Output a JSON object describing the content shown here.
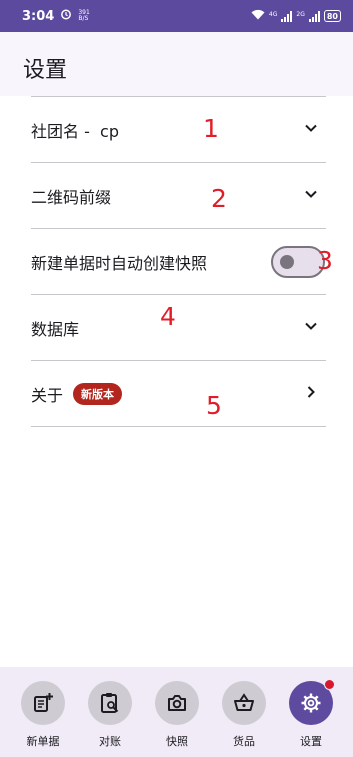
{
  "status_bar": {
    "time": "3:04",
    "speed_value": "391",
    "speed_unit": "B/S",
    "net_tag_1": "4G",
    "net_tag_2": "2G",
    "battery": "80"
  },
  "header": {
    "title": "设置"
  },
  "settings": {
    "items": [
      {
        "label": "社团名 -  cp",
        "control": "chevron-down",
        "marker": "1"
      },
      {
        "label": "二维码前缀",
        "control": "chevron-down",
        "marker": "2"
      },
      {
        "label": "新建单据时自动创建快照",
        "control": "toggle",
        "toggle_on": false,
        "marker": "3"
      },
      {
        "label": "数据库",
        "control": "chevron-down",
        "marker": "4"
      },
      {
        "label": "关于",
        "badge": "新版本",
        "control": "chevron-right",
        "marker": "5"
      }
    ]
  },
  "bottom_nav": {
    "items": [
      {
        "label": "新单据",
        "icon": "new-document-icon"
      },
      {
        "label": "对账",
        "icon": "clipboard-search-icon"
      },
      {
        "label": "快照",
        "icon": "camera-icon"
      },
      {
        "label": "货品",
        "icon": "basket-icon"
      },
      {
        "label": "设置",
        "icon": "gear-icon",
        "active": true,
        "notification": true
      }
    ]
  },
  "colors": {
    "accent": "#5e4a9f",
    "status_bar": "#5b4a9e",
    "badge": "#b3261e",
    "marker": "#e01e2a"
  }
}
